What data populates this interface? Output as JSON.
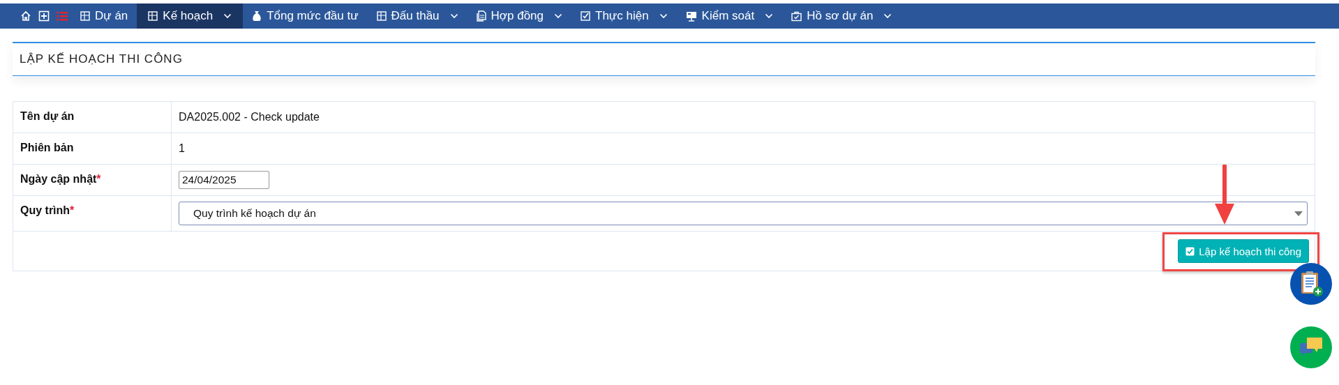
{
  "nav": {
    "items": [
      {
        "label": "Dự án",
        "selected": false,
        "dropdown": false
      },
      {
        "label": "Kế hoạch",
        "selected": true,
        "dropdown": true
      },
      {
        "label": "Tổng mức đầu tư",
        "selected": false,
        "dropdown": false
      },
      {
        "label": "Đấu thầu",
        "selected": false,
        "dropdown": true
      },
      {
        "label": "Hợp đồng",
        "selected": false,
        "dropdown": true
      },
      {
        "label": "Thực hiện",
        "selected": false,
        "dropdown": true
      },
      {
        "label": "Kiểm soát",
        "selected": false,
        "dropdown": true
      },
      {
        "label": "Hồ sơ dự án",
        "selected": false,
        "dropdown": true
      }
    ]
  },
  "page_title": "LẬP KẾ HOẠCH THI CÔNG",
  "form": {
    "rows": [
      {
        "kind": "text",
        "label": "Tên dự án",
        "value": "DA2025.002 - Check update"
      },
      {
        "kind": "text",
        "label": "Phiên bản",
        "value": "1"
      },
      {
        "kind": "date",
        "label": "Ngày cập nhật",
        "required_mark": "*",
        "value": "24/04/2025"
      },
      {
        "kind": "select",
        "label": "Quy trình",
        "required_mark": "*",
        "value": "Quy trình kế hoạch dự án"
      }
    ],
    "submit": {
      "label": "Lập kế hoạch thi công",
      "highlighted": true
    }
  }
}
